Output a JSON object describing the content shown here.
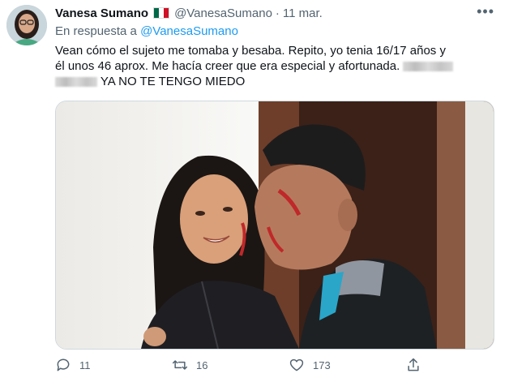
{
  "tweet": {
    "author_name": "Vanesa Sumano",
    "author_handle": "@VanesaSumano",
    "separator": "·",
    "date": "11 mar.",
    "reply_prefix": "En respuesta a",
    "reply_handle": "@VanesaSumano",
    "text_line1": "Vean cómo el sujeto me tomaba y besaba. Repito, yo tenia 16/17 años y",
    "text_line2": "él unos 46 aprox. Me hacía creer que era especial y afortunada.",
    "text_line3": "YA NO TE TENGO MIEDO"
  },
  "icons": {
    "flag": "mexico-flag-icon",
    "more": "more-options-icon",
    "reply": "reply-icon",
    "retweet": "retweet-icon",
    "like": "like-icon",
    "share": "share-icon"
  },
  "actions": {
    "replies": "11",
    "retweets": "16",
    "likes": "173"
  },
  "colors": {
    "link": "#1d9bf0",
    "muted": "#536471",
    "text": "#0f1419"
  }
}
